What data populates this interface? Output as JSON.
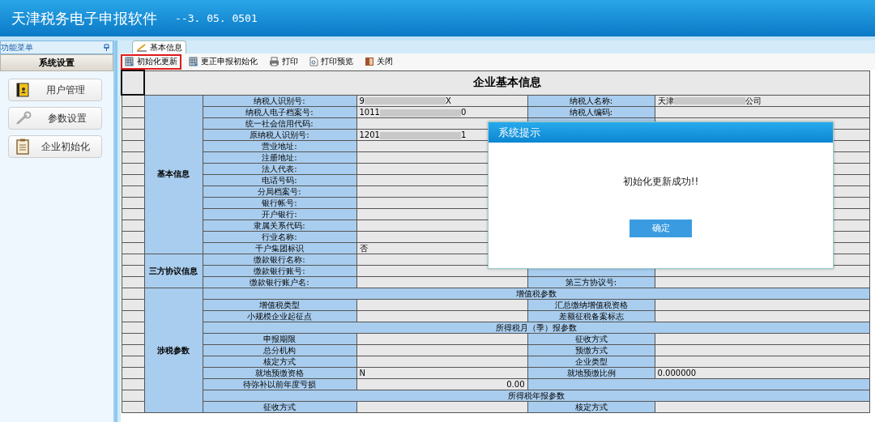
{
  "app": {
    "title": "天津税务电子申报软件",
    "version": "--3. 05. 0501"
  },
  "sidebar": {
    "panel_title": "功能菜单",
    "section": "系统设置",
    "items": [
      {
        "label": "用户管理"
      },
      {
        "label": "参数设置"
      },
      {
        "label": "企业初始化"
      }
    ]
  },
  "tab": {
    "label": "基本信息"
  },
  "toolbar": {
    "items": [
      {
        "label": "初始化更新",
        "highlighted": true
      },
      {
        "label": "更正申报初始化",
        "highlighted": false
      },
      {
        "label": "打印",
        "highlighted": false
      },
      {
        "label": "打印预览",
        "highlighted": false
      },
      {
        "label": "关闭",
        "highlighted": false
      }
    ]
  },
  "form": {
    "title": "企业基本信息",
    "sections": [
      {
        "title": "基本信息",
        "rows": [
          {
            "kind": "pair",
            "label": "纳税人识别号:",
            "value_head": "9",
            "value_tail": "X",
            "label2": "纳税人名称:",
            "value2_head": "天津",
            "value2_tail": "公司"
          },
          {
            "kind": "pair",
            "label": "纳税人电子档案号:",
            "value_head": "1011",
            "value_tail": "0",
            "label2": "纳税人编码:"
          },
          {
            "kind": "pair",
            "label": "统一社会信用代码:"
          },
          {
            "kind": "pair",
            "label": "原纳税人识别号:",
            "value_head": "1201",
            "value_tail": "1"
          },
          {
            "kind": "pair",
            "label": "营业地址:"
          },
          {
            "kind": "pair",
            "label": "注册地址:"
          },
          {
            "kind": "pair",
            "label": "法人代表:"
          },
          {
            "kind": "pair",
            "label": "电话号码:"
          },
          {
            "kind": "pair",
            "label": "分局档案号:"
          },
          {
            "kind": "pair",
            "label": "银行帐号:"
          },
          {
            "kind": "pair",
            "label": "开户银行:"
          },
          {
            "kind": "pair",
            "label": "隶属关系代码:"
          },
          {
            "kind": "pair",
            "label": "行业名称:"
          },
          {
            "kind": "pair",
            "label": "千户集团标识",
            "value": "否"
          }
        ]
      },
      {
        "title": "三方协议信息",
        "rows": [
          {
            "kind": "pair",
            "label": "缴款银行名称:"
          },
          {
            "kind": "pair",
            "label": "缴款银行账号:"
          },
          {
            "kind": "pair",
            "label": "缴款银行账户名:",
            "label2": "第三方协议号:"
          }
        ]
      },
      {
        "title": "涉税参数",
        "rows": [
          {
            "kind": "header",
            "text": "增值税参数"
          },
          {
            "kind": "pair",
            "label": "增值税类型",
            "label2": "汇总缴纳增值税资格"
          },
          {
            "kind": "pair",
            "label": "小规模企业起征点",
            "label2": "差额征税备案标志"
          },
          {
            "kind": "header",
            "text": "所得税月（季）报参数"
          },
          {
            "kind": "pair",
            "label": "申报期限",
            "label2": "征收方式"
          },
          {
            "kind": "pair",
            "label": "总分机构",
            "label2": "预缴方式"
          },
          {
            "kind": "pair",
            "label": "核定方式",
            "label2": "企业类型"
          },
          {
            "kind": "pair",
            "label": "就地预缴资格",
            "value": "N",
            "label2": "就地预缴比例",
            "value2": "0.000000"
          },
          {
            "kind": "amount",
            "label": "待弥补以前年度亏损",
            "value": "0.00"
          },
          {
            "kind": "header",
            "text": "所得税年报参数"
          },
          {
            "kind": "pair",
            "label": "征收方式",
            "label2": "核定方式"
          }
        ]
      }
    ]
  },
  "dialog": {
    "title": "系统提示",
    "message": "初始化更新成功!!",
    "button": "确定"
  }
}
